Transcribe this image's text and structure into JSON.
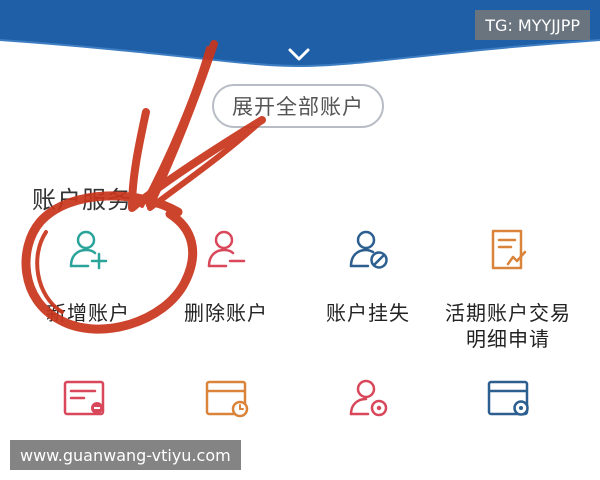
{
  "header": {
    "expand_label": "展开全部账户"
  },
  "section": {
    "title": "账户服务"
  },
  "services": [
    {
      "label": "新增账户",
      "icon": "user-add-icon"
    },
    {
      "label": "删除账户",
      "icon": "user-remove-icon"
    },
    {
      "label": "账户挂失",
      "icon": "user-block-icon"
    },
    {
      "label_line1": "活期账户交易",
      "label_line2": "明细申请",
      "icon": "document-chart-icon"
    },
    {
      "icon": "document-wrench-icon"
    },
    {
      "icon": "card-clock-icon"
    },
    {
      "icon": "user-settings-icon"
    },
    {
      "icon": "card-settings-icon"
    }
  ],
  "watermarks": {
    "tg": "TG: MYYJJPP",
    "url": "www.guanwang-vtiyu.com"
  },
  "colors": {
    "teal": "#2aa39a",
    "red": "#d8485a",
    "navy": "#2c5f8f",
    "orange": "#d9843a",
    "banner": "#1f5fa8",
    "annotation": "#c9351c"
  }
}
